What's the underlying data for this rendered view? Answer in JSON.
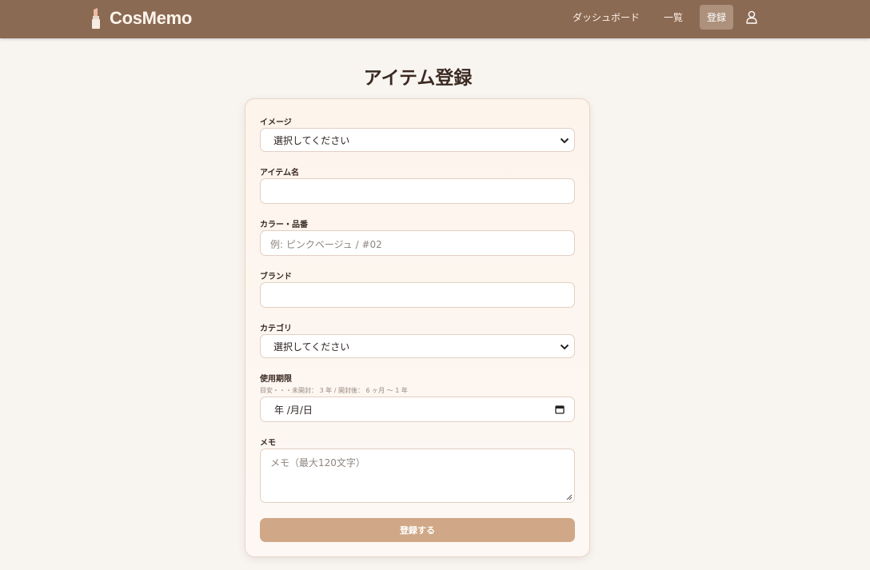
{
  "app": {
    "name": "CosMemo",
    "brand_icon": "lipstick-icon"
  },
  "nav": {
    "dashboard": "ダッシュボード",
    "list": "一覧",
    "register": "登録",
    "user_icon": "user-icon"
  },
  "page": {
    "title": "アイテム登録"
  },
  "form": {
    "image": {
      "label": "イメージ",
      "value": "選択してください"
    },
    "item_name": {
      "label": "アイテム名",
      "value": ""
    },
    "color": {
      "label": "カラー・品番",
      "placeholder": "例: ピンクベージュ / #02"
    },
    "brand": {
      "label": "ブランド",
      "value": ""
    },
    "category": {
      "label": "カテゴリ",
      "value": "選択してください"
    },
    "expiry": {
      "label": "使用期限",
      "hint": "目安・・・未開封： 3 年 / 開封後： 6 ヶ月 ～ 1 年",
      "value": "年 /月/日"
    },
    "memo": {
      "label": "メモ",
      "placeholder": "メモ（最大120文字）"
    },
    "submit": "登録する"
  },
  "colors": {
    "navbar": "#8b6a54",
    "nav_active": "#ad917c",
    "submit_button": "#d0a887",
    "background": "#f8f5f1"
  }
}
